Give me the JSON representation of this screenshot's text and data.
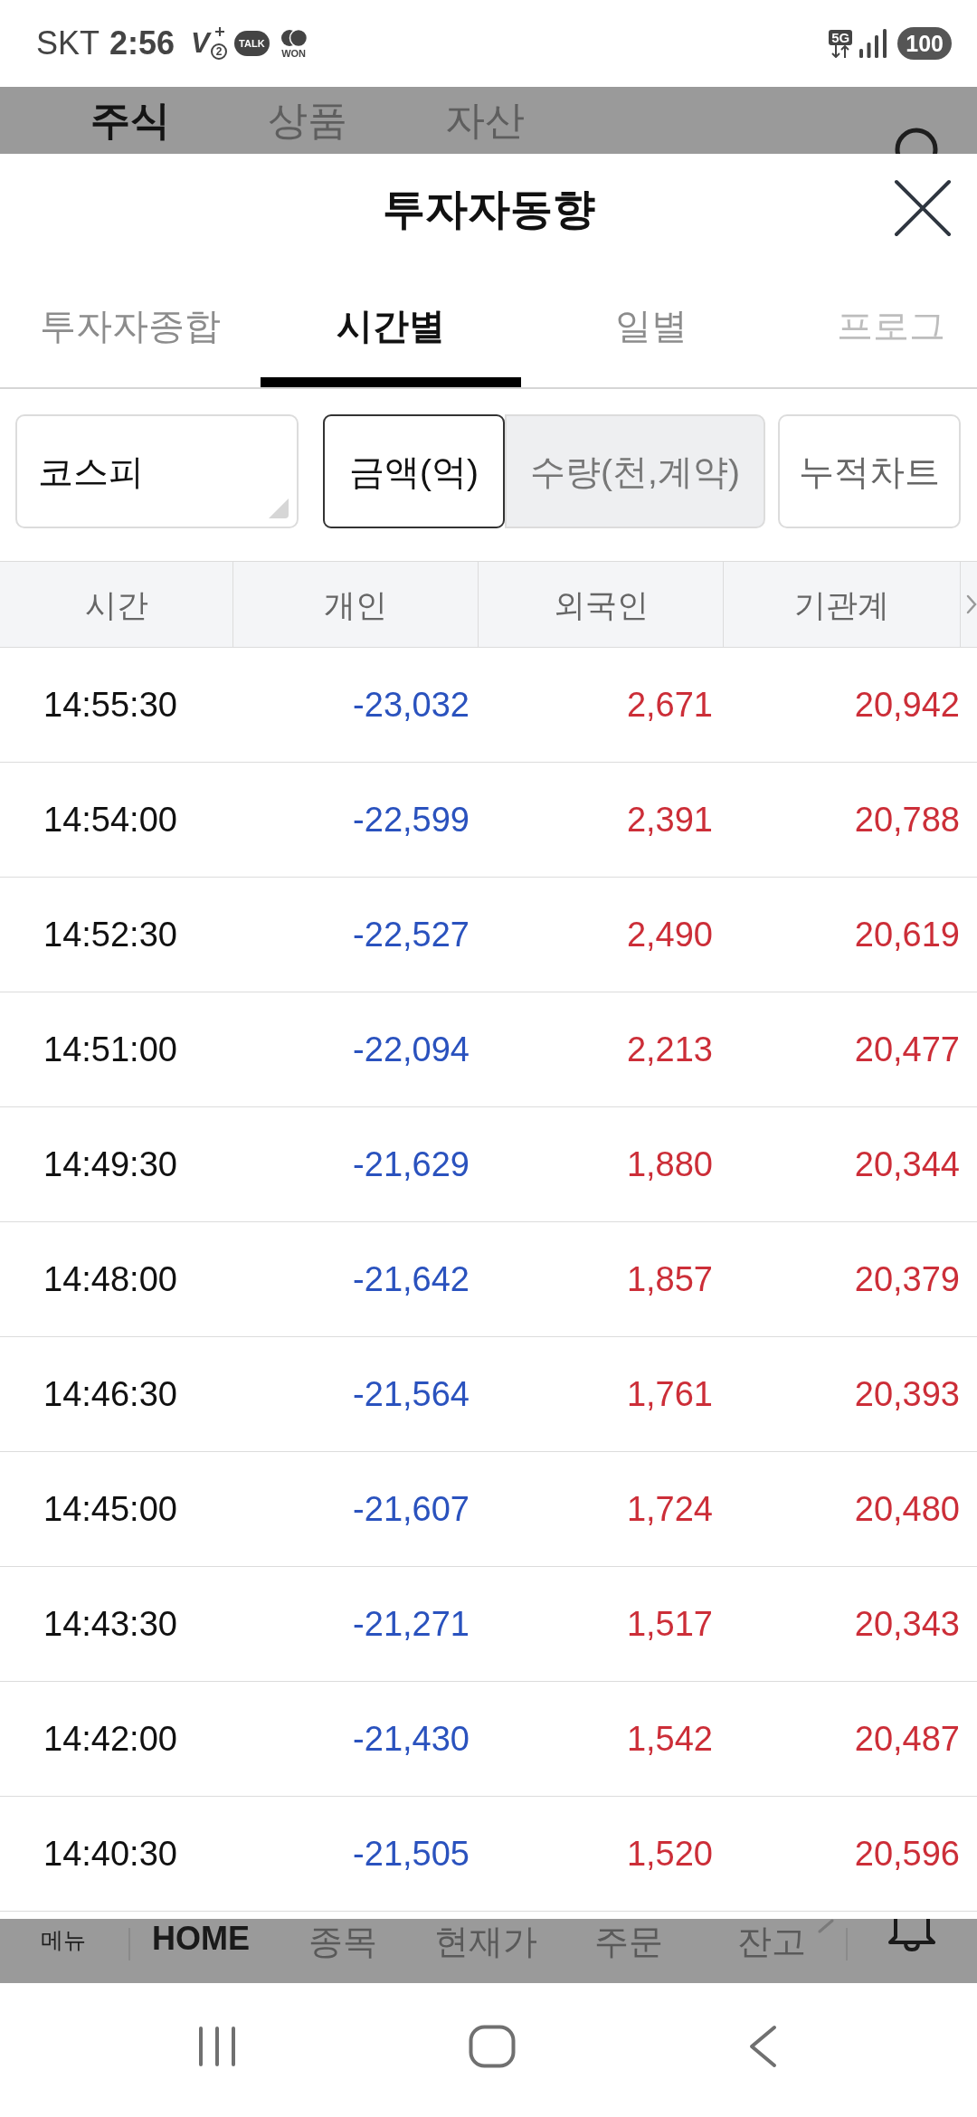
{
  "status_bar": {
    "carrier": "SKT",
    "time": "2:56",
    "notifications": [
      {
        "kind": "v",
        "label": "V",
        "badge": "2"
      },
      {
        "kind": "talk",
        "label": "TALK"
      },
      {
        "kind": "won",
        "label": "WON"
      }
    ],
    "network": "5G",
    "battery": "100"
  },
  "background_app": {
    "tabs": [
      {
        "label": "주식",
        "selected": true
      },
      {
        "label": "상품",
        "selected": false
      },
      {
        "label": "자산",
        "selected": false
      }
    ],
    "bottom_menu": {
      "menu_label": "메뉴",
      "home_label": "HOME",
      "items": [
        "종목",
        "현재가",
        "주문",
        "잔고"
      ]
    }
  },
  "modal": {
    "title": "투자자동향",
    "tabs": [
      {
        "label": "투자자종합",
        "selected": false
      },
      {
        "label": "시간별",
        "selected": true
      },
      {
        "label": "일별",
        "selected": false
      },
      {
        "label": "프로그",
        "selected": false
      }
    ],
    "market_select": {
      "value": "코스피"
    },
    "unit_toggle": [
      {
        "label": "금액(억)",
        "selected": true
      },
      {
        "label": "수량(천,계약)",
        "selected": false
      }
    ],
    "chart_button": "누적차트",
    "table": {
      "columns": [
        "시간",
        "개인",
        "외국인",
        "기관계"
      ],
      "rows": [
        {
          "time": "14:55:30",
          "values": [
            {
              "text": "-23,032",
              "color": "#2a52be"
            },
            {
              "text": "2,671",
              "color": "#cc2e38"
            },
            {
              "text": "20,942",
              "color": "#cc2e38"
            }
          ]
        },
        {
          "time": "14:54:00",
          "values": [
            {
              "text": "-22,599",
              "color": "#2a52be"
            },
            {
              "text": "2,391",
              "color": "#cc2e38"
            },
            {
              "text": "20,788",
              "color": "#cc2e38"
            }
          ]
        },
        {
          "time": "14:52:30",
          "values": [
            {
              "text": "-22,527",
              "color": "#2a52be"
            },
            {
              "text": "2,490",
              "color": "#cc2e38"
            },
            {
              "text": "20,619",
              "color": "#cc2e38"
            }
          ]
        },
        {
          "time": "14:51:00",
          "values": [
            {
              "text": "-22,094",
              "color": "#2a52be"
            },
            {
              "text": "2,213",
              "color": "#cc2e38"
            },
            {
              "text": "20,477",
              "color": "#cc2e38"
            }
          ]
        },
        {
          "time": "14:49:30",
          "values": [
            {
              "text": "-21,629",
              "color": "#2a52be"
            },
            {
              "text": "1,880",
              "color": "#cc2e38"
            },
            {
              "text": "20,344",
              "color": "#cc2e38"
            }
          ]
        },
        {
          "time": "14:48:00",
          "values": [
            {
              "text": "-21,642",
              "color": "#2a52be"
            },
            {
              "text": "1,857",
              "color": "#cc2e38"
            },
            {
              "text": "20,379",
              "color": "#cc2e38"
            }
          ]
        },
        {
          "time": "14:46:30",
          "values": [
            {
              "text": "-21,564",
              "color": "#2a52be"
            },
            {
              "text": "1,761",
              "color": "#cc2e38"
            },
            {
              "text": "20,393",
              "color": "#cc2e38"
            }
          ]
        },
        {
          "time": "14:45:00",
          "values": [
            {
              "text": "-21,607",
              "color": "#2a52be"
            },
            {
              "text": "1,724",
              "color": "#cc2e38"
            },
            {
              "text": "20,480",
              "color": "#cc2e38"
            }
          ]
        },
        {
          "time": "14:43:30",
          "values": [
            {
              "text": "-21,271",
              "color": "#2a52be"
            },
            {
              "text": "1,517",
              "color": "#cc2e38"
            },
            {
              "text": "20,343",
              "color": "#cc2e38"
            }
          ]
        },
        {
          "time": "14:42:00",
          "values": [
            {
              "text": "-21,430",
              "color": "#2a52be"
            },
            {
              "text": "1,542",
              "color": "#cc2e38"
            },
            {
              "text": "20,487",
              "color": "#cc2e38"
            }
          ]
        },
        {
          "time": "14:40:30",
          "values": [
            {
              "text": "-21,505",
              "color": "#2a52be"
            },
            {
              "text": "1,520",
              "color": "#cc2e38"
            },
            {
              "text": "20,596",
              "color": "#cc2e38"
            }
          ]
        }
      ]
    }
  }
}
